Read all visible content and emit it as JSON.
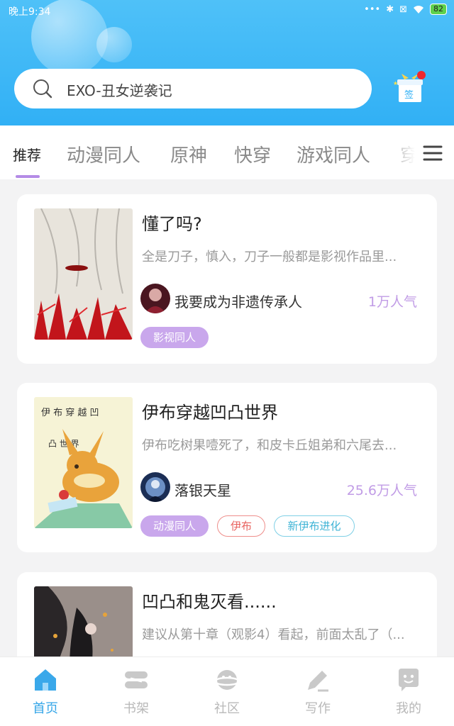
{
  "status": {
    "time": "晚上9:34",
    "battery": "82"
  },
  "search": {
    "text": "EXO-丑女逆袭记"
  },
  "checkin": {
    "label": "签"
  },
  "tabs": [
    {
      "label": "推荐"
    },
    {
      "label": "动漫同人"
    },
    {
      "label": "原神"
    },
    {
      "label": "快穿"
    },
    {
      "label": "游戏同人"
    },
    {
      "label": "穿越"
    }
  ],
  "books": [
    {
      "title": "懂了吗?",
      "desc": "全是刀子，慎入，刀子一般都是影视作品里...",
      "author": "我要成为非遗传承人",
      "popularity": "1万人气",
      "tags": [
        "影视同人"
      ]
    },
    {
      "title": "伊布穿越凹凸世界",
      "desc": "伊布吃树果噎死了，和皮卡丘姐弟和六尾去...",
      "author": "落银天星",
      "popularity": "25.6万人气",
      "tags": [
        "动漫同人",
        "伊布",
        "新伊布进化"
      ]
    },
    {
      "title": "凹凸和鬼灭看......",
      "desc": "建议从第十章（观影4）看起，前面太乱了（..."
    }
  ],
  "nav": [
    {
      "label": "首页",
      "icon": "home-icon"
    },
    {
      "label": "书架",
      "icon": "bookshelf-icon"
    },
    {
      "label": "社区",
      "icon": "planet-icon"
    },
    {
      "label": "写作",
      "icon": "pen-icon"
    },
    {
      "label": "我的",
      "icon": "chat-face-icon"
    }
  ],
  "colors": {
    "header": "#3fb8f7",
    "accent": "#35a6e8",
    "tag_purple": "#c9a7ec"
  }
}
